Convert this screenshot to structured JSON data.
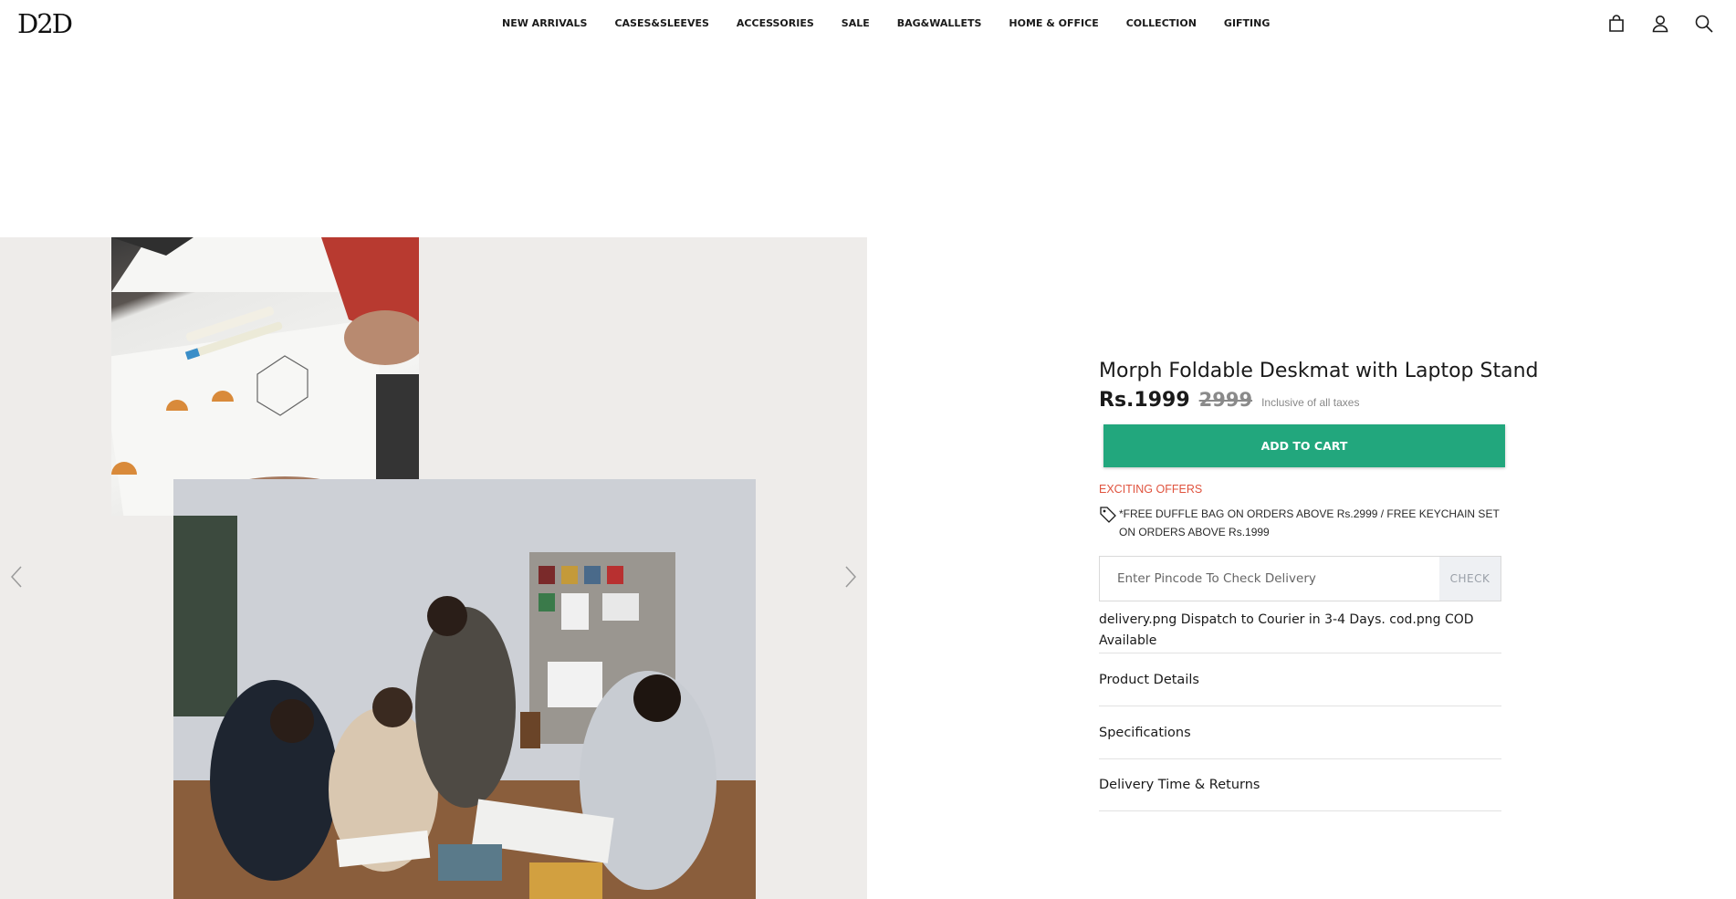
{
  "header": {
    "logo": "D2D",
    "nav": [
      "NEW ARRIVALS",
      "CASES&SLEEVES",
      "ACCESSORIES",
      "SALE",
      "BAG&WALLETS",
      "HOME & OFFICE",
      "COLLECTION",
      "GIFTING"
    ],
    "icons": [
      "bag-icon",
      "user-icon",
      "search-icon"
    ]
  },
  "gallery": {
    "prev_icon": "chevron-left-icon",
    "next_icon": "chevron-right-icon"
  },
  "product": {
    "title": "Morph Foldable Deskmat with Laptop Stand",
    "price": "Rs.1999",
    "mrp": "2999",
    "tax_note": "Inclusive of all taxes",
    "add_to_cart": "ADD TO CART",
    "offers_heading": "EXCITING OFFERS",
    "offer_text": "*FREE DUFFLE BAG ON ORDERS ABOVE Rs.2999 / FREE KEYCHAIN SET ON ORDERS ABOVE Rs.1999",
    "pincode_placeholder": "Enter Pincode To Check Delivery",
    "check_label": "CHECK",
    "delivery_text": "delivery.png Dispatch to Courier in 3-4 Days. cod.png COD Available",
    "accordions": [
      "Product Details",
      "Specifications",
      "Delivery Time & Returns"
    ]
  },
  "colors": {
    "accent": "#22a77d",
    "offer_red": "#e0533e",
    "gallery_bg": "#eeecea"
  }
}
